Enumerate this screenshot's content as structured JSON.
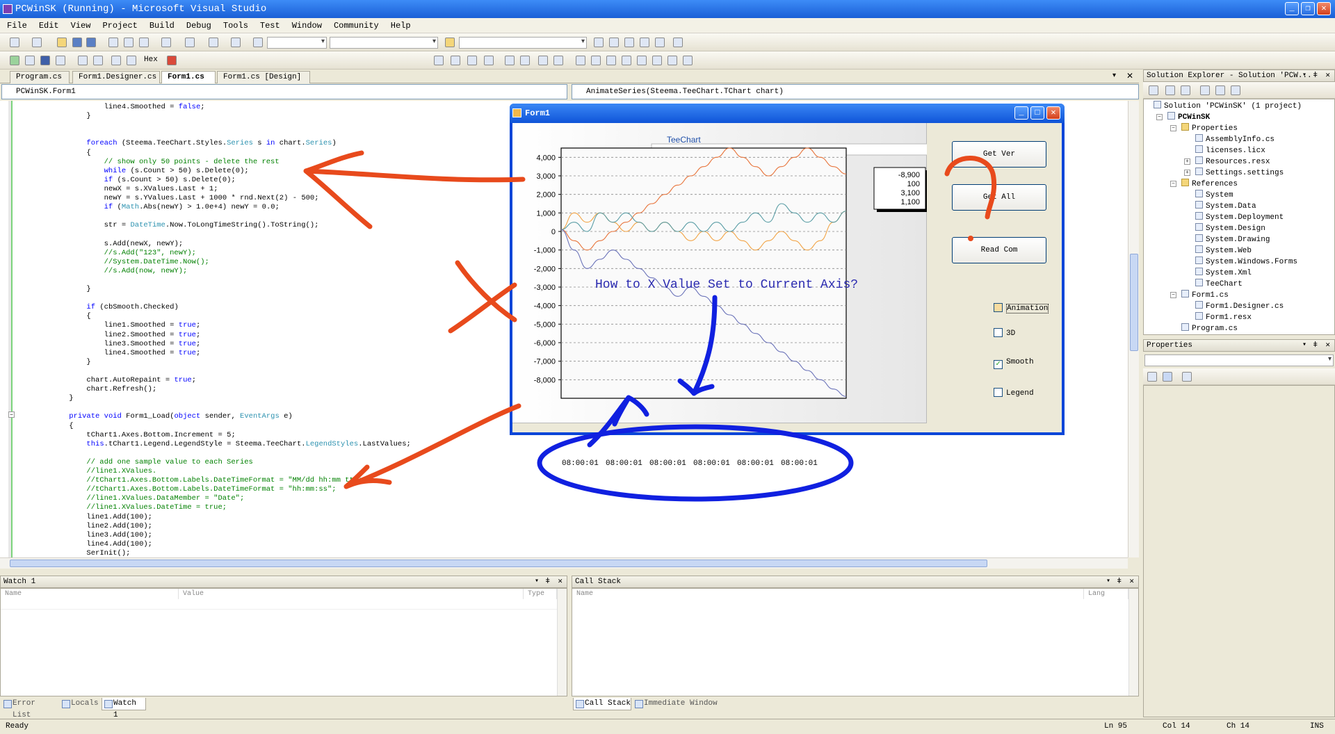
{
  "window": {
    "title": "PCWinSK (Running) - Microsoft Visual Studio"
  },
  "menu": [
    "File",
    "Edit",
    "View",
    "Project",
    "Build",
    "Debug",
    "Tools",
    "Test",
    "Window",
    "Community",
    "Help"
  ],
  "toolbar": {
    "hex_label": "Hex"
  },
  "tabs": [
    "Program.cs",
    "Form1.Designer.cs",
    "Form1.cs",
    "Form1.cs [Design]"
  ],
  "active_tab": "Form1.cs",
  "nav": {
    "class_combo": "PCWinSK.Form1",
    "member_combo": "AnimateSeries(Steema.TeeChart.TChart chart)"
  },
  "code": [
    {
      "t": "            line4.Smoothed = false;",
      "c": "plain"
    },
    {
      "t": "        }",
      "c": "plain"
    },
    {
      "t": "",
      "c": "plain"
    },
    {
      "t": "",
      "c": "plain"
    },
    {
      "t": "        foreach (Steema.TeeChart.Styles.Series s in chart.Series)",
      "c": "plain"
    },
    {
      "t": "        {",
      "c": "plain"
    },
    {
      "t": "            // show only 50 points - delete the rest",
      "c": "cm"
    },
    {
      "t": "            while (s.Count > 50) s.Delete(0);",
      "c": "plain"
    },
    {
      "t": "            if (s.Count > 50) s.Delete(0);",
      "c": "plain"
    },
    {
      "t": "            newX = s.XValues.Last + 1;",
      "c": "plain"
    },
    {
      "t": "            newY = s.YValues.Last + 1000 * rnd.Next(2) - 500;",
      "c": "plain"
    },
    {
      "t": "            if (Math.Abs(newY) > 1.0e+4) newY = 0.0;",
      "c": "plain"
    },
    {
      "t": "",
      "c": "plain"
    },
    {
      "t": "            str = DateTime.Now.ToLongTimeString().ToString();",
      "c": "plain"
    },
    {
      "t": "",
      "c": "plain"
    },
    {
      "t": "            s.Add(newX, newY);",
      "c": "plain"
    },
    {
      "t": "            //s.Add(\"123\", newY);",
      "c": "cm"
    },
    {
      "t": "            //System.DateTime.Now();",
      "c": "cm"
    },
    {
      "t": "            //s.Add(now, newY);",
      "c": "cm"
    },
    {
      "t": "",
      "c": "plain"
    },
    {
      "t": "        }",
      "c": "plain"
    },
    {
      "t": "",
      "c": "plain"
    },
    {
      "t": "        if (cbSmooth.Checked)",
      "c": "plain"
    },
    {
      "t": "        {",
      "c": "plain"
    },
    {
      "t": "            line1.Smoothed = true;",
      "c": "plain"
    },
    {
      "t": "            line2.Smoothed = true;",
      "c": "plain"
    },
    {
      "t": "            line3.Smoothed = true;",
      "c": "plain"
    },
    {
      "t": "            line4.Smoothed = true;",
      "c": "plain"
    },
    {
      "t": "        }",
      "c": "plain"
    },
    {
      "t": "",
      "c": "plain"
    },
    {
      "t": "        chart.AutoRepaint = true;",
      "c": "plain"
    },
    {
      "t": "        chart.Refresh();",
      "c": "plain"
    },
    {
      "t": "    }",
      "c": "plain"
    },
    {
      "t": "",
      "c": "plain"
    },
    {
      "t": "    private void Form1_Load(object sender, EventArgs e)",
      "c": "plain"
    },
    {
      "t": "    {",
      "c": "plain"
    },
    {
      "t": "        tChart1.Axes.Bottom.Increment = 5;",
      "c": "plain"
    },
    {
      "t": "        this.tChart1.Legend.LegendStyle = Steema.TeeChart.LegendStyles.LastValues;",
      "c": "plain"
    },
    {
      "t": "",
      "c": "plain"
    },
    {
      "t": "        // add one sample value to each Series",
      "c": "cm"
    },
    {
      "t": "        //line1.XValues.",
      "c": "cm"
    },
    {
      "t": "        //tChart1.Axes.Bottom.Labels.DateTimeFormat = \"MM/dd hh:mm tt\";",
      "c": "cm"
    },
    {
      "t": "        //tChart1.Axes.Bottom.Labels.DateTimeFormat = \"hh:mm:ss\";",
      "c": "cm"
    },
    {
      "t": "        //line1.XValues.DataMember = \"Date\";",
      "c": "cm"
    },
    {
      "t": "        //line1.XValues.DateTime = true;",
      "c": "cm"
    },
    {
      "t": "        line1.Add(100);",
      "c": "plain"
    },
    {
      "t": "        line2.Add(100);",
      "c": "plain"
    },
    {
      "t": "        line3.Add(100);",
      "c": "plain"
    },
    {
      "t": "        line4.Add(100);",
      "c": "plain"
    },
    {
      "t": "        SerInit();",
      "c": "plain"
    },
    {
      "t": "    }",
      "c": "plain"
    }
  ],
  "form1": {
    "title": "Form1",
    "chart_title": "TeeChart",
    "buttons": [
      "Get Ver",
      "Get All",
      "Read Com"
    ],
    "checkboxes": [
      {
        "label": "Animation",
        "checked": false
      },
      {
        "label": "3D",
        "checked": false
      },
      {
        "label": "Smooth",
        "checked": true
      },
      {
        "label": "Legend",
        "checked": false
      }
    ],
    "legend_values": [
      "-8,900",
      "100",
      "3,100",
      "1,100"
    ]
  },
  "chart_data": {
    "type": "line",
    "title": "TeeChart",
    "ylim": [
      -9000,
      4500
    ],
    "yticks": [
      "4,000",
      "3,000",
      "2,000",
      "1,000",
      "0",
      "-1,000",
      "-2,000",
      "-3,000",
      "-4,000",
      "-5,000",
      "-6,000",
      "-7,000",
      "-8,000"
    ],
    "ytick_values": [
      4000,
      3000,
      2000,
      1000,
      0,
      -1000,
      -2000,
      -3000,
      -4000,
      -5000,
      -6000,
      -7000,
      -8000
    ],
    "series": [
      {
        "color": "#e8743b",
        "values": [
          100,
          -500,
          -1000,
          -500,
          0,
          500,
          1000,
          1500,
          2000,
          2500,
          3000,
          3500,
          4000,
          4500,
          4000,
          3500,
          3000,
          3500,
          4000,
          4500,
          4000,
          3500,
          3100
        ]
      },
      {
        "color": "#f2a447",
        "values": [
          100,
          1000,
          500,
          1000,
          500,
          0,
          500,
          0,
          500,
          0,
          -500,
          0,
          -500,
          0,
          -500,
          -1000,
          -500,
          0,
          -500,
          -1000,
          -500,
          500,
          1100
        ]
      },
      {
        "color": "#5b9ea6",
        "values": [
          100,
          500,
          0,
          1000,
          500,
          1000,
          500,
          0,
          500,
          0,
          500,
          0,
          500,
          0,
          500,
          1000,
          500,
          1500,
          1000,
          500,
          1000,
          500,
          1100
        ]
      },
      {
        "color": "#6b73b9",
        "values": [
          100,
          -1000,
          -2000,
          -1500,
          -1000,
          -1500,
          -2000,
          -2500,
          -3000,
          -3500,
          -3000,
          -3500,
          -4000,
          -4500,
          -5000,
          -5500,
          -6000,
          -6500,
          -7000,
          -7500,
          -8000,
          -8500,
          -8900
        ]
      }
    ]
  },
  "overlays": {
    "question": "How to X Value Set to Current Axis?",
    "time_labels": [
      "08:00:01",
      "08:00:01",
      "08:00:01",
      "08:00:01",
      "08:00:01",
      "08:00:01"
    ]
  },
  "solution_explorer": {
    "title": "Solution Explorer - Solution 'PCW...",
    "items": [
      {
        "label": "Solution 'PCWinSK' (1 project)",
        "level": 0,
        "bold": false,
        "icon": "solution-icon"
      },
      {
        "label": "PCWinSK",
        "level": 1,
        "bold": true,
        "icon": "project-icon"
      },
      {
        "label": "Properties",
        "level": 2,
        "bold": false,
        "icon": "folder-icon"
      },
      {
        "label": "AssemblyInfo.cs",
        "level": 3,
        "bold": false,
        "icon": "file-icon"
      },
      {
        "label": "licenses.licx",
        "level": 3,
        "bold": false,
        "icon": "file-icon"
      },
      {
        "label": "Resources.resx",
        "level": 3,
        "bold": false,
        "icon": "file-icon"
      },
      {
        "label": "Settings.settings",
        "level": 3,
        "bold": false,
        "icon": "file-icon"
      },
      {
        "label": "References",
        "level": 2,
        "bold": false,
        "icon": "folder-icon"
      },
      {
        "label": "System",
        "level": 3,
        "bold": false,
        "icon": "reference-icon"
      },
      {
        "label": "System.Data",
        "level": 3,
        "bold": false,
        "icon": "reference-icon"
      },
      {
        "label": "System.Deployment",
        "level": 3,
        "bold": false,
        "icon": "reference-icon"
      },
      {
        "label": "System.Design",
        "level": 3,
        "bold": false,
        "icon": "reference-icon"
      },
      {
        "label": "System.Drawing",
        "level": 3,
        "bold": false,
        "icon": "reference-icon"
      },
      {
        "label": "System.Web",
        "level": 3,
        "bold": false,
        "icon": "reference-icon"
      },
      {
        "label": "System.Windows.Forms",
        "level": 3,
        "bold": false,
        "icon": "reference-icon"
      },
      {
        "label": "System.Xml",
        "level": 3,
        "bold": false,
        "icon": "reference-icon"
      },
      {
        "label": "TeeChart",
        "level": 3,
        "bold": false,
        "icon": "reference-icon"
      },
      {
        "label": "Form1.cs",
        "level": 2,
        "bold": false,
        "icon": "form-icon"
      },
      {
        "label": "Form1.Designer.cs",
        "level": 3,
        "bold": false,
        "icon": "file-icon"
      },
      {
        "label": "Form1.resx",
        "level": 3,
        "bold": false,
        "icon": "file-icon"
      },
      {
        "label": "Program.cs",
        "level": 2,
        "bold": false,
        "icon": "file-icon"
      }
    ]
  },
  "properties": {
    "title": "Properties"
  },
  "watch": {
    "title": "Watch 1",
    "columns": [
      "Name",
      "Value",
      "Type"
    ],
    "tabs": [
      "Error List",
      "Locals",
      "Watch 1"
    ],
    "active_tab": "Watch 1"
  },
  "callstack": {
    "title": "Call Stack",
    "columns": [
      "Name",
      "Lang"
    ],
    "tabs": [
      "Call Stack",
      "Immediate Window"
    ],
    "active_tab": "Call Stack"
  },
  "status": {
    "text": "Ready",
    "ln": "Ln 95",
    "col": "Col 14",
    "ch": "Ch 14",
    "mode": "INS"
  }
}
